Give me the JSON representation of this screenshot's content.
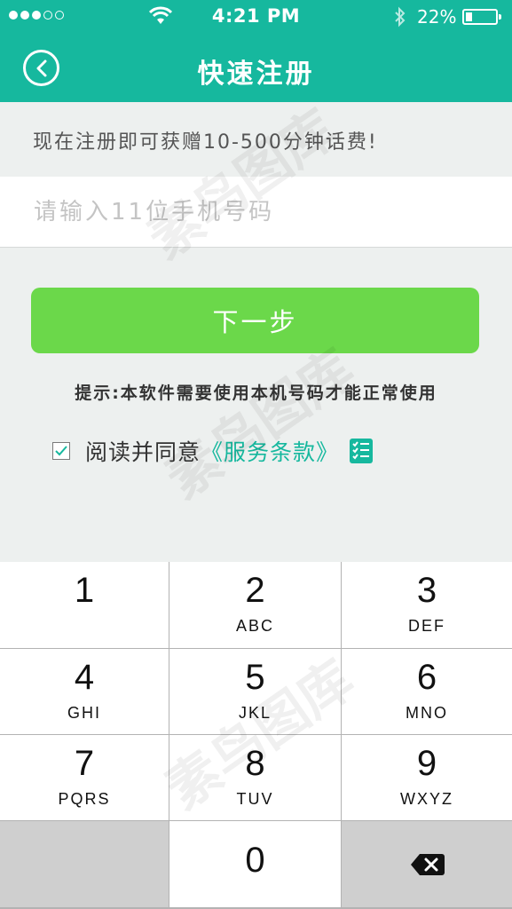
{
  "status_bar": {
    "time": "4:21 PM",
    "battery_percent_label": "22%",
    "battery_level": 0.22,
    "signal_filled": 3,
    "signal_total": 5
  },
  "header": {
    "title": "快速注册",
    "back_icon": "chevron-left-circle-icon"
  },
  "promo_text": "现在注册即可获赠10-500分钟话费!",
  "phone_input": {
    "placeholder": "请输入11位手机号码",
    "value": ""
  },
  "next_button_label": "下一步",
  "hint_text": "提示:本软件需要使用本机号码才能正常使用",
  "agreement": {
    "checked": true,
    "text": "阅读并同意",
    "terms_link": "《服务条款》"
  },
  "keypad": {
    "keys": [
      {
        "digit": "1",
        "letters": ""
      },
      {
        "digit": "2",
        "letters": "ABC"
      },
      {
        "digit": "3",
        "letters": "DEF"
      },
      {
        "digit": "4",
        "letters": "GHI"
      },
      {
        "digit": "5",
        "letters": "JKL"
      },
      {
        "digit": "6",
        "letters": "MNO"
      },
      {
        "digit": "7",
        "letters": "PQRS"
      },
      {
        "digit": "8",
        "letters": "TUV"
      },
      {
        "digit": "9",
        "letters": "WXYZ"
      },
      {
        "digit": "0",
        "letters": ""
      }
    ]
  },
  "watermark_text": "素鸟图库",
  "colors": {
    "header_teal": "#16b89e",
    "button_green": "#6bd84a",
    "link_teal": "#16b89e",
    "background": "#edf0ef"
  }
}
